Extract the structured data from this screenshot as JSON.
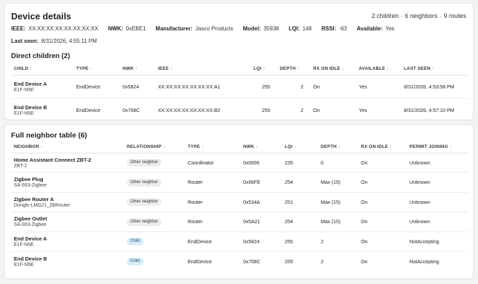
{
  "details": {
    "title": "Device details",
    "summary": [
      "2 children",
      "6 neighbors",
      "9 routes"
    ],
    "info_row1": [
      {
        "k": "IEEE:",
        "v": "XX:XX:XX:XX:XX:XX:XX:XX"
      },
      {
        "k": "NWK:",
        "v": "0xEBE1"
      },
      {
        "k": "Manufacturer:",
        "v": "Jasco Products"
      },
      {
        "k": "Model:",
        "v": "35938"
      },
      {
        "k": "LQI:",
        "v": "148"
      },
      {
        "k": "RSSI:",
        "v": "-63"
      },
      {
        "k": "Available:",
        "v": "Yes"
      }
    ],
    "last_seen_label": "Last seen:",
    "last_seen_value": "8/31/2026, 4:55:11 PM"
  },
  "children": {
    "title": "Direct children (2)",
    "headers": [
      "CHILD",
      "TYPE",
      "NWK",
      "IEEE",
      "LQI",
      "DEPTH",
      "RX ON IDLE",
      "AVAILABLE",
      "LAST SEEN"
    ],
    "rows": [
      {
        "name": "End Device A",
        "sub": "E1F-N5E",
        "type": "EndDevice",
        "nwk": "0x5824",
        "ieee": "XX:XX:XX:XX:XX:XX:XX:A1",
        "lqi": "255",
        "depth": "2",
        "rx": "On",
        "available": "Yes",
        "last_seen": "8/31/2026, 4:53:58 PM"
      },
      {
        "name": "End Device B",
        "sub": "E1F-N5E",
        "type": "EndDevice",
        "nwk": "0x708C",
        "ieee": "XX:XX:XX:XX:XX:XX:XX:B2",
        "lqi": "255",
        "depth": "2",
        "rx": "On",
        "available": "Yes",
        "last_seen": "8/31/2026, 4:57:10 PM"
      }
    ]
  },
  "neighbors": {
    "title": "Full neighbor table (6)",
    "headers": [
      "NEIGHBOR",
      "RELATIONSHIP",
      "TYPE",
      "NWK",
      "LQI",
      "DEPTH",
      "RX ON IDLE",
      "PERMIT JOINING"
    ],
    "rows": [
      {
        "name": "Home Assistant Connect ZBT-2",
        "sub": "ZBT-2",
        "relationship": "Other neighbor",
        "type": "Coordinator",
        "nwk": "0x0000",
        "lqi": "235",
        "depth": "0",
        "rx": "On",
        "permit": "Unknown"
      },
      {
        "name": "Zigbee Plug",
        "sub": "SA-003-Zigbee",
        "relationship": "Other neighbor",
        "type": "Router",
        "nwk": "0x06FE",
        "lqi": "254",
        "depth": "Max (15)",
        "rx": "On",
        "permit": "Unknown"
      },
      {
        "name": "Zigbee Router A",
        "sub": "Dongle-LMG21_ZBRouter",
        "relationship": "Other neighbor",
        "type": "Router",
        "nwk": "0x534A",
        "lqi": "251",
        "depth": "Max (15)",
        "rx": "On",
        "permit": "Unknown"
      },
      {
        "name": "Zigbee Outlet",
        "sub": "SA-003-Zigbee",
        "relationship": "Other neighbor",
        "type": "Router",
        "nwk": "0x5A21",
        "lqi": "254",
        "depth": "Max (15)",
        "rx": "On",
        "permit": "Unknown"
      },
      {
        "name": "End Device A",
        "sub": "E1F-N5E",
        "relationship": "Child",
        "type": "EndDevice",
        "nwk": "0x5824",
        "lqi": "255",
        "depth": "2",
        "rx": "On",
        "permit": "NotAccepting"
      },
      {
        "name": "End Device B",
        "sub": "E1F-N5E",
        "relationship": "Child",
        "type": "EndDevice",
        "nwk": "0x708C",
        "lqi": "255",
        "depth": "2",
        "rx": "On",
        "permit": "NotAccepting"
      }
    ]
  },
  "sort_glyph": "↕"
}
